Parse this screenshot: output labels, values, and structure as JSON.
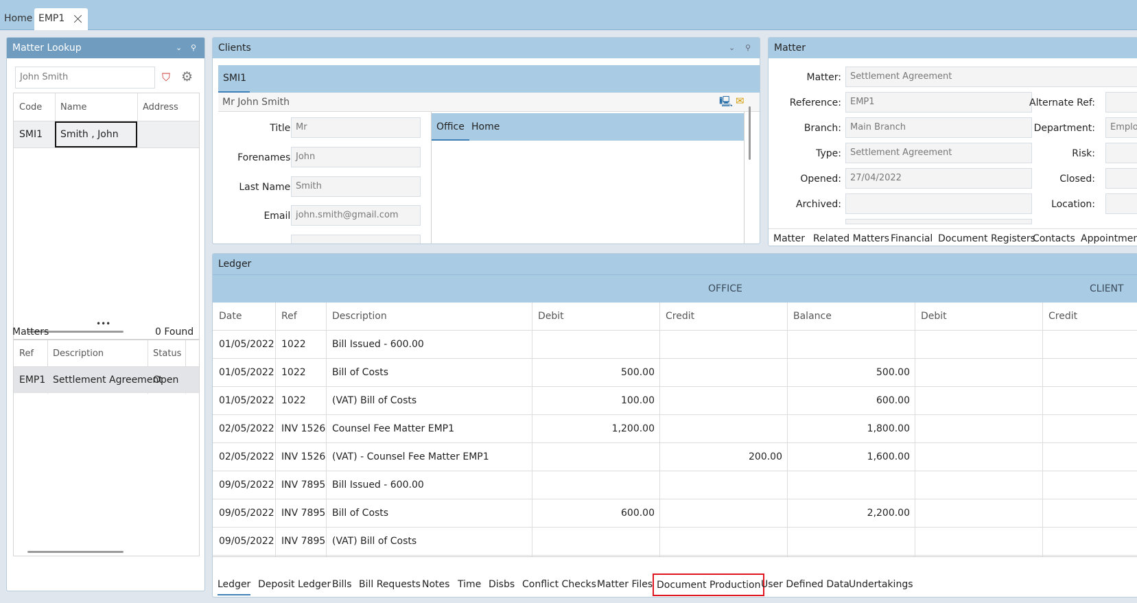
{
  "doc_tabs": [
    "Home",
    "EMP1"
  ],
  "matter_lookup": {
    "title": "Matter Lookup",
    "search_value": "John Smith",
    "columns": [
      "Code",
      "Name",
      "Address"
    ],
    "row": {
      "code": "SMI1",
      "name": "Smith , John",
      "address": ""
    },
    "matters_label": "Matters",
    "found_label": "0 Found",
    "matter_columns": [
      "Ref",
      "Description",
      "Status"
    ],
    "matter_row": {
      "ref": "EMP1",
      "description": "Settlement Agreement",
      "status": "Open"
    }
  },
  "clients": {
    "title": "Clients",
    "tab": "SMI1",
    "client_name": "Mr John Smith",
    "fields": {
      "title_label": "Title:",
      "title_value": "Mr",
      "forenames_label": "Forenames:",
      "forenames_value": "John",
      "lastname_label": "Last Name:",
      "lastname_value": "Smith",
      "email_label": "Email:",
      "email_value": "john.smith@gmail.com"
    },
    "address_tabs": [
      "Office",
      "Home"
    ]
  },
  "matter": {
    "title": "Matter",
    "matter_label": "Matter:",
    "matter_value": "Settlement Agreement",
    "reference_label": "Reference:",
    "reference_value": "EMP1",
    "branch_label": "Branch:",
    "branch_value": "Main Branch",
    "type_label": "Type:",
    "type_value": "Settlement Agreement",
    "opened_label": "Opened:",
    "opened_value": "27/04/2022",
    "archived_label": "Archived:",
    "archived_value": "",
    "alt_ref_label": "Alternate Ref:",
    "department_label": "Department:",
    "department_value": "Employ",
    "risk_label": "Risk:",
    "closed_label": "Closed:",
    "location_label": "Location:",
    "tabs": [
      "Matter",
      "Related Matters",
      "Financial",
      "Document Registers",
      "Contacts",
      "Appointment"
    ]
  },
  "ledger": {
    "title": "Ledger",
    "group_office": "OFFICE",
    "group_client": "CLIENT",
    "columns": [
      "Date",
      "Ref",
      "Description",
      "Debit",
      "Credit",
      "Balance",
      "Debit",
      "Credit"
    ],
    "rows": [
      [
        "01/05/2022",
        "1022",
        "Bill Issued - 600.00",
        "",
        "",
        ""
      ],
      [
        "01/05/2022",
        "1022",
        "Bill of Costs",
        "500.00",
        "",
        "500.00"
      ],
      [
        "01/05/2022",
        "1022",
        "(VAT) Bill of Costs",
        "100.00",
        "",
        "600.00"
      ],
      [
        "02/05/2022",
        "INV 1526",
        "Counsel Fee Matter EMP1",
        "1,200.00",
        "",
        "1,800.00"
      ],
      [
        "02/05/2022",
        "INV 1526",
        "(VAT) - Counsel Fee Matter EMP1",
        "",
        "200.00",
        "1,600.00"
      ],
      [
        "09/05/2022",
        "INV 7895",
        "Bill Issued - 600.00",
        "",
        "",
        ""
      ],
      [
        "09/05/2022",
        "INV 7895",
        "Bill of Costs",
        "600.00",
        "",
        "2,200.00"
      ],
      [
        "09/05/2022",
        "INV 7895",
        "(VAT) Bill of Costs",
        "",
        "",
        ""
      ]
    ],
    "bottom_tabs": [
      "Ledger",
      "Deposit Ledger",
      "Bills",
      "Bill Requests",
      "Notes",
      "Time",
      "Disbs",
      "Conflict Checks",
      "Matter Files",
      "Document Production",
      "User Defined Data",
      "Undertakings"
    ],
    "highlighted_tab": "Document Production"
  },
  "colors": {
    "header_blue": "#a9cbe3",
    "dark_header": "#6f9cbf",
    "highlight_red": "#e0141e"
  }
}
